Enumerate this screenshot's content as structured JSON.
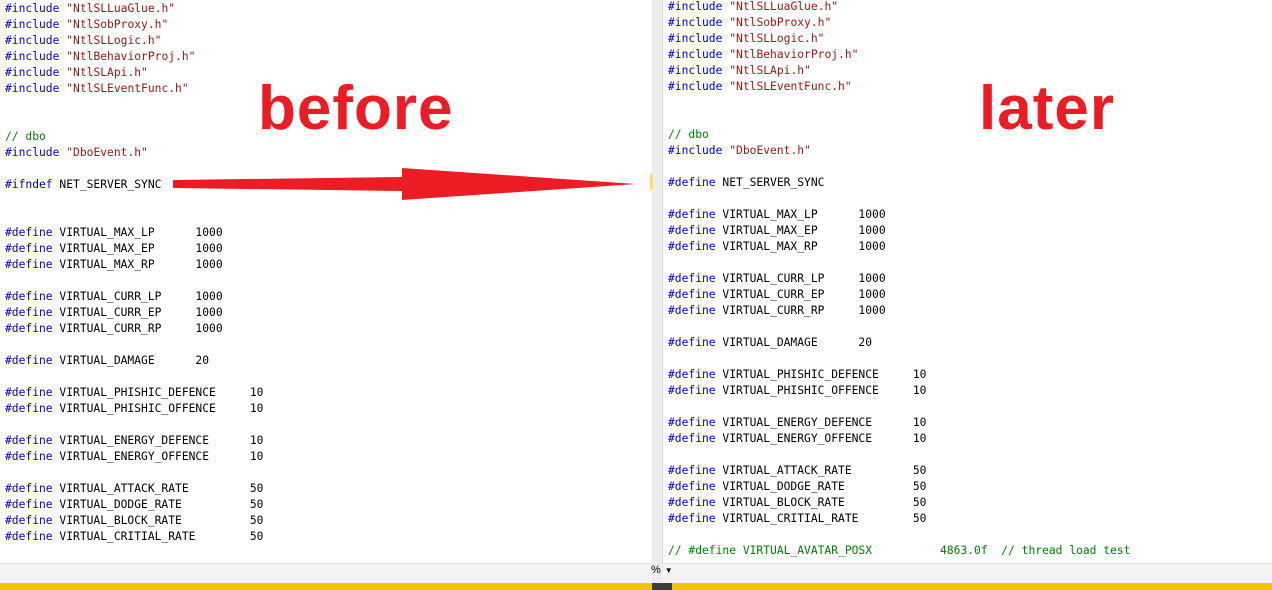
{
  "before_label": "before",
  "after_label": "later",
  "zoom": "%",
  "left_lines": [
    [
      [
        "kw",
        "#include"
      ],
      [
        "t",
        " "
      ],
      [
        "str",
        "\"NtlSLLuaGlue.h\""
      ]
    ],
    [
      [
        "kw",
        "#include"
      ],
      [
        "t",
        " "
      ],
      [
        "str",
        "\"NtlSobProxy.h\""
      ]
    ],
    [
      [
        "kw",
        "#include"
      ],
      [
        "t",
        " "
      ],
      [
        "str",
        "\"NtlSLLogic.h\""
      ]
    ],
    [
      [
        "kw",
        "#include"
      ],
      [
        "t",
        " "
      ],
      [
        "str",
        "\"NtlBehaviorProj.h\""
      ]
    ],
    [
      [
        "kw",
        "#include"
      ],
      [
        "t",
        " "
      ],
      [
        "str",
        "\"NtlSLApi.h\""
      ]
    ],
    [
      [
        "kw",
        "#include"
      ],
      [
        "t",
        " "
      ],
      [
        "str",
        "\"NtlSLEventFunc.h\""
      ]
    ],
    [],
    [],
    [
      [
        "cm",
        "// dbo"
      ]
    ],
    [
      [
        "kw",
        "#include"
      ],
      [
        "t",
        " "
      ],
      [
        "str",
        "\"DboEvent.h\""
      ]
    ],
    [],
    [
      [
        "kw",
        "#ifndef"
      ],
      [
        "t",
        " NET_SERVER_SYNC"
      ]
    ],
    [],
    [],
    [
      [
        "kw",
        "#define"
      ],
      [
        "t",
        " VIRTUAL_MAX_LP      1000"
      ]
    ],
    [
      [
        "kw",
        "#define"
      ],
      [
        "t",
        " VIRTUAL_MAX_EP      1000"
      ]
    ],
    [
      [
        "kw",
        "#define"
      ],
      [
        "t",
        " VIRTUAL_MAX_RP      1000"
      ]
    ],
    [],
    [
      [
        "kw",
        "#define"
      ],
      [
        "t",
        " VIRTUAL_CURR_LP     1000"
      ]
    ],
    [
      [
        "kw",
        "#define"
      ],
      [
        "t",
        " VIRTUAL_CURR_EP     1000"
      ]
    ],
    [
      [
        "kw",
        "#define"
      ],
      [
        "t",
        " VIRTUAL_CURR_RP     1000"
      ]
    ],
    [],
    [
      [
        "kw",
        "#define"
      ],
      [
        "t",
        " VIRTUAL_DAMAGE      20"
      ]
    ],
    [],
    [
      [
        "kw",
        "#define"
      ],
      [
        "t",
        " VIRTUAL_PHISHIC_DEFENCE     10"
      ]
    ],
    [
      [
        "kw",
        "#define"
      ],
      [
        "t",
        " VIRTUAL_PHISHIC_OFFENCE     10"
      ]
    ],
    [],
    [
      [
        "kw",
        "#define"
      ],
      [
        "t",
        " VIRTUAL_ENERGY_DEFENCE      10"
      ]
    ],
    [
      [
        "kw",
        "#define"
      ],
      [
        "t",
        " VIRTUAL_ENERGY_OFFENCE      10"
      ]
    ],
    [],
    [
      [
        "kw",
        "#define"
      ],
      [
        "t",
        " VIRTUAL_ATTACK_RATE         50"
      ]
    ],
    [
      [
        "kw",
        "#define"
      ],
      [
        "t",
        " VIRTUAL_DODGE_RATE          50"
      ]
    ],
    [
      [
        "kw",
        "#define"
      ],
      [
        "t",
        " VIRTUAL_BLOCK_RATE          50"
      ]
    ],
    [
      [
        "kw",
        "#define"
      ],
      [
        "t",
        " VIRTUAL_CRITIAL_RATE        50"
      ]
    ]
  ],
  "right_lines": [
    [
      [
        "kw",
        "#include"
      ],
      [
        "t",
        " "
      ],
      [
        "str",
        "\"NtlSLLuaGlue.h\""
      ]
    ],
    [
      [
        "kw",
        "#include"
      ],
      [
        "t",
        " "
      ],
      [
        "str",
        "\"NtlSobProxy.h\""
      ]
    ],
    [
      [
        "kw",
        "#include"
      ],
      [
        "t",
        " "
      ],
      [
        "str",
        "\"NtlSLLogic.h\""
      ]
    ],
    [
      [
        "kw",
        "#include"
      ],
      [
        "t",
        " "
      ],
      [
        "str",
        "\"NtlBehaviorProj.h\""
      ]
    ],
    [
      [
        "kw",
        "#include"
      ],
      [
        "t",
        " "
      ],
      [
        "str",
        "\"NtlSLApi.h\""
      ]
    ],
    [
      [
        "kw",
        "#include"
      ],
      [
        "t",
        " "
      ],
      [
        "str",
        "\"NtlSLEventFunc.h\""
      ]
    ],
    [],
    [],
    [
      [
        "cm",
        "// dbo"
      ]
    ],
    [
      [
        "kw",
        "#include"
      ],
      [
        "t",
        " "
      ],
      [
        "str",
        "\"DboEvent.h\""
      ]
    ],
    [],
    [
      [
        "kw",
        "#define"
      ],
      [
        "t",
        " NET_SERVER_SYNC"
      ]
    ],
    [],
    [
      [
        "kw",
        "#define"
      ],
      [
        "t",
        " VIRTUAL_MAX_LP      1000"
      ]
    ],
    [
      [
        "kw",
        "#define"
      ],
      [
        "t",
        " VIRTUAL_MAX_EP      1000"
      ]
    ],
    [
      [
        "kw",
        "#define"
      ],
      [
        "t",
        " VIRTUAL_MAX_RP      1000"
      ]
    ],
    [],
    [
      [
        "kw",
        "#define"
      ],
      [
        "t",
        " VIRTUAL_CURR_LP     1000"
      ]
    ],
    [
      [
        "kw",
        "#define"
      ],
      [
        "t",
        " VIRTUAL_CURR_EP     1000"
      ]
    ],
    [
      [
        "kw",
        "#define"
      ],
      [
        "t",
        " VIRTUAL_CURR_RP     1000"
      ]
    ],
    [],
    [
      [
        "kw",
        "#define"
      ],
      [
        "t",
        " VIRTUAL_DAMAGE      20"
      ]
    ],
    [],
    [
      [
        "kw",
        "#define"
      ],
      [
        "t",
        " VIRTUAL_PHISHIC_DEFENCE     10"
      ]
    ],
    [
      [
        "kw",
        "#define"
      ],
      [
        "t",
        " VIRTUAL_PHISHIC_OFFENCE     10"
      ]
    ],
    [],
    [
      [
        "kw",
        "#define"
      ],
      [
        "t",
        " VIRTUAL_ENERGY_DEFENCE      10"
      ]
    ],
    [
      [
        "kw",
        "#define"
      ],
      [
        "t",
        " VIRTUAL_ENERGY_OFFENCE      10"
      ]
    ],
    [],
    [
      [
        "kw",
        "#define"
      ],
      [
        "t",
        " VIRTUAL_ATTACK_RATE         50"
      ]
    ],
    [
      [
        "kw",
        "#define"
      ],
      [
        "t",
        " VIRTUAL_DODGE_RATE          50"
      ]
    ],
    [
      [
        "kw",
        "#define"
      ],
      [
        "t",
        " VIRTUAL_BLOCK_RATE          50"
      ]
    ],
    [
      [
        "kw",
        "#define"
      ],
      [
        "t",
        " VIRTUAL_CRITIAL_RATE        50"
      ]
    ],
    [],
    [
      [
        "cm",
        "// #define VIRTUAL_AVATAR_POSX          4863.0f  // thread load test"
      ]
    ]
  ],
  "colors": {
    "keyword": "#0000c8",
    "string": "#a31515",
    "comment": "#008000",
    "annotation": "#ed1c24"
  }
}
